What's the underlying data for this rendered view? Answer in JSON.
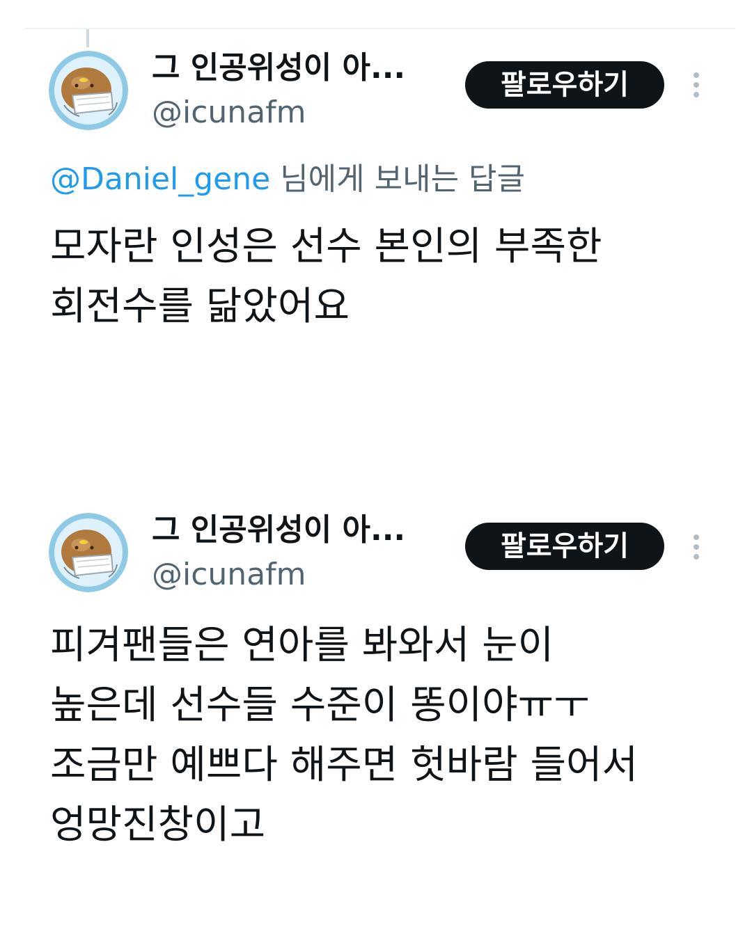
{
  "tweets": [
    {
      "author": {
        "display_name": "그 인공위성이 아...",
        "handle": "@icunafm",
        "avatar_icon": "potato-character-avatar"
      },
      "follow_label": "팔로우하기",
      "more_icon": "more-vertical-icon",
      "reply_to": {
        "mention": "@Daniel_gene",
        "suffix": " 님에게 보내는 답글"
      },
      "text_lines": [
        "모자란 인성은  선수 본인의 부족한",
        "회전수를 닮았어요"
      ]
    },
    {
      "author": {
        "display_name": "그 인공위성이 아...",
        "handle": "@icunafm",
        "avatar_icon": "potato-character-avatar"
      },
      "follow_label": "팔로우하기",
      "more_icon": "more-vertical-icon",
      "text_lines": [
        "피겨팬들은 연아를 봐와서 눈이",
        "높은데 선수들 수준이 똥이야ㅠㅜ",
        "조금만 예쁘다 해주면 헛바람 들어서",
        "엉망진창이고"
      ]
    }
  ],
  "colors": {
    "text_primary": "#0f1419",
    "text_secondary": "#536471",
    "link": "#1d9bf0",
    "button_bg": "#0f1419",
    "button_text": "#ffffff",
    "avatar_ring": "#8ecae6"
  }
}
